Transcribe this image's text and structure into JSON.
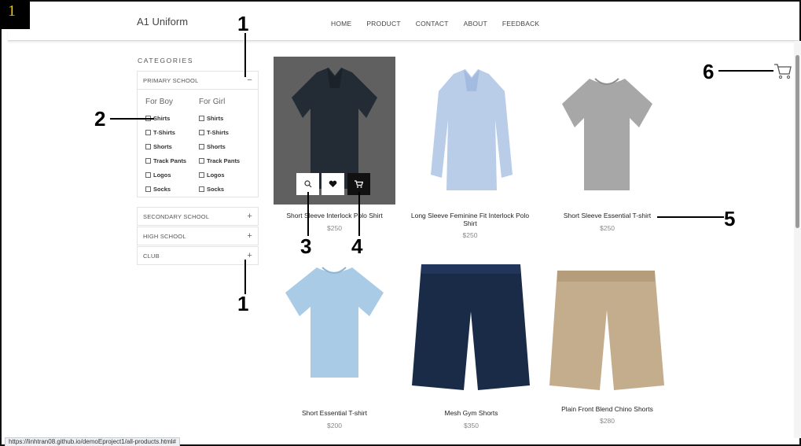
{
  "badge": "1",
  "brand": "A1 Uniform",
  "nav": [
    "HOME",
    "PRODUCT",
    "CONTACT",
    "ABOUT",
    "FEEDBACK"
  ],
  "sidebar": {
    "title": "CATEGORIES",
    "primary": {
      "label": "PRIMARY SCHOOL",
      "sign": "−",
      "boy": {
        "title": "For Boy",
        "items": [
          "Shirts",
          "T-Shirts",
          "Shorts",
          "Track Pants",
          "Logos",
          "Socks"
        ]
      },
      "girl": {
        "title": "For Girl",
        "items": [
          "Shirts",
          "T-Shirts",
          "Shorts",
          "Track Pants",
          "Logos",
          "Socks"
        ]
      }
    },
    "secondary": {
      "label": "SECONDARY SCHOOL",
      "sign": "+"
    },
    "high": {
      "label": "HIGH SCHOOL",
      "sign": "+"
    },
    "club": {
      "label": "CLUB",
      "sign": "+"
    }
  },
  "products": [
    {
      "name": "Short Sleeve Interlock Polo Shirt",
      "price": "$250",
      "icon": "polo-shirt-dark"
    },
    {
      "name": "Long Sleeve Feminine Fit Interlock Polo Shirt",
      "price": "$250",
      "icon": "polo-shirt-light-blue"
    },
    {
      "name": "Short Sleeve Essential T-shirt",
      "price": "$250",
      "icon": "tshirt-gray"
    },
    {
      "name": "Short Essential T-shirt",
      "price": "$200",
      "icon": "tshirt-light-blue"
    },
    {
      "name": "Mesh Gym Shorts",
      "price": "$350",
      "icon": "shorts-navy"
    },
    {
      "name": "Plain Front Blend Chino Shorts",
      "price": "$280",
      "icon": "shorts-khaki"
    }
  ],
  "hover_actions": [
    "search-icon",
    "heart-icon",
    "cart-icon"
  ],
  "status_url": "https://linhtran08.github.io/demoEproject1/all-products.html#",
  "annotations": [
    "1",
    "2",
    "3",
    "4",
    "5",
    "6",
    "1"
  ],
  "colors": {
    "badge_bg": "#000000",
    "badge_text": "#f5c400",
    "overlay": "rgba(0,0,0,0.32)"
  }
}
